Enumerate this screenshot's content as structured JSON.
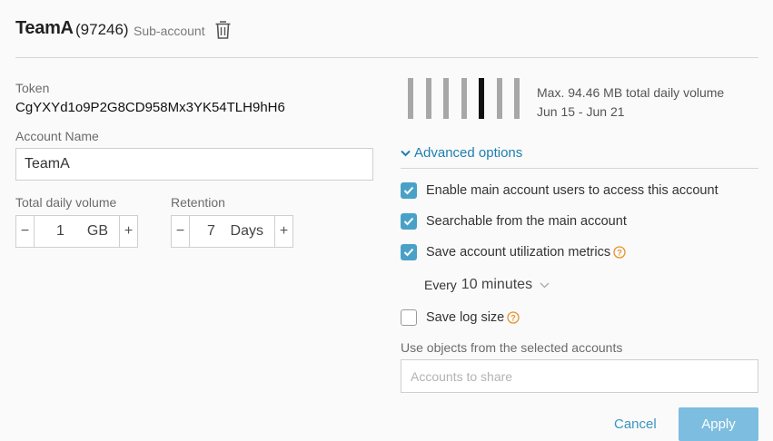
{
  "header": {
    "account_name": "TeamA",
    "account_id": "(97246)",
    "account_type": "Sub-account",
    "delete_icon": "trash-icon"
  },
  "token": {
    "label": "Token",
    "value": "CgYXYd1o9P2G8CD958Mx3YK54TLH9hH6"
  },
  "account_name_field": {
    "label": "Account Name",
    "value": "TeamA"
  },
  "total_daily_volume": {
    "label": "Total daily volume",
    "value": "1",
    "unit": "GB",
    "decrement_icon": "minus-icon",
    "increment_icon": "plus-icon"
  },
  "retention": {
    "label": "Retention",
    "value": "7",
    "unit": "Days",
    "decrement_icon": "minus-icon",
    "increment_icon": "plus-icon"
  },
  "volume_chart": {
    "bar_count": 7,
    "active_bar_index": 4,
    "bar_color": "#a7a7a7",
    "active_color": "#111111"
  },
  "volume_info": {
    "max_text": "Max. 94.46 MB total daily volume",
    "date_range": "Jun 15 - Jun 21"
  },
  "advanced": {
    "label": "Advanced options",
    "expanded": true,
    "link_color": "#1f7eb0"
  },
  "options": [
    {
      "label": "Enable main account users to access this account",
      "checked": true,
      "help": false
    },
    {
      "label": "Searchable from the main account",
      "checked": true,
      "help": false
    },
    {
      "label": "Save account utilization metrics",
      "checked": true,
      "help": true
    },
    {
      "label": "Save log size",
      "checked": false,
      "help": true
    }
  ],
  "metrics_interval": {
    "prefix": "Every",
    "value": "10 minutes"
  },
  "share": {
    "label": "Use objects from the selected accounts",
    "placeholder": "Accounts to share"
  },
  "actions": {
    "cancel_label": "Cancel",
    "apply_label": "Apply"
  },
  "colors": {
    "checkbox": "#4aa1c7",
    "apply_button": "#7cbde0",
    "help_icon": "#e8922a"
  }
}
